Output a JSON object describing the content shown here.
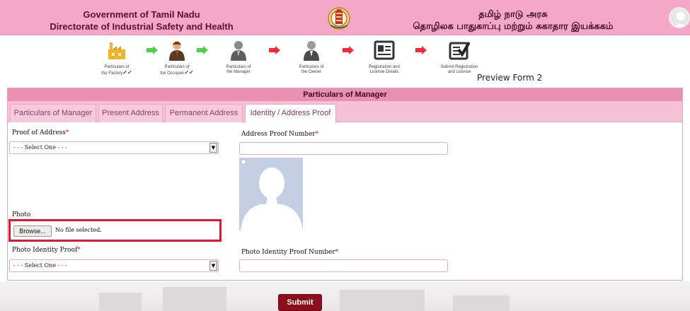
{
  "header": {
    "left_line1": "Government of Tamil Nadu",
    "left_line2": "Directorate of Industrial Safety and Health",
    "right_line1": "தமிழ் நாடு அரசு",
    "right_line2": "தொழிலக பாதுகாப்பு மற்றும் சுகாதார இயக்ககம்",
    "emblem_icon": "tamil-nadu-emblem-icon",
    "avatar_icon": "user-avatar-icon"
  },
  "wizard": {
    "steps": [
      {
        "line1": "Particulars of",
        "line2": "the Factory",
        "check": "✓✓",
        "icon": "factory-icon"
      },
      {
        "line1": "Particulars of",
        "line2": "the Occupier",
        "check": "✓✓",
        "icon": "occupier-icon"
      },
      {
        "line1": "Particulars of",
        "line2": "the Manager",
        "check": "",
        "icon": "manager-icon"
      },
      {
        "line1": "Particulars of",
        "line2": "the Owner",
        "check": "",
        "icon": "owner-icon"
      },
      {
        "line1": "Registration and",
        "line2": "License Details",
        "check": "",
        "icon": "license-card-icon"
      },
      {
        "line1": "Submit Registration",
        "line2": "and License",
        "check": "",
        "icon": "submit-checklist-icon"
      }
    ],
    "preview_label": "Preview Form 2"
  },
  "panel": {
    "title": "Particulars of Manager",
    "tabs": [
      {
        "label": "Particulars of Manager",
        "active": false
      },
      {
        "label": "Present Address",
        "active": false
      },
      {
        "label": "Permanent Address",
        "active": false
      },
      {
        "label": "Identity / Address Proof",
        "active": true
      }
    ]
  },
  "form": {
    "proof_of_address_label": "Proof of Address",
    "proof_of_address_value": "- - - Select One - - -",
    "address_proof_number_label": "Address Proof Number",
    "address_proof_number_value": "",
    "photo_label": "Photo",
    "browse_label": "Browse...",
    "file_status": "No file selected.",
    "photo_identity_proof_label": "Photo Identity Proof",
    "photo_identity_proof_value": "- - - Select One - - -",
    "photo_identity_proof_number_label": "Photo Identity Proof Number",
    "photo_identity_proof_number_value": "",
    "required_marker": "*"
  },
  "submit_label": "Submit",
  "colors": {
    "header_bg": "#f4a7c6",
    "panel_title_bg": "#ea8fb1",
    "tab_bar_bg": "#f6c0d5",
    "required": "#d3003a",
    "submit_bg": "#8e0d1c",
    "highlight_border": "#e3172d",
    "step_done_check": "#1a3fd6"
  }
}
